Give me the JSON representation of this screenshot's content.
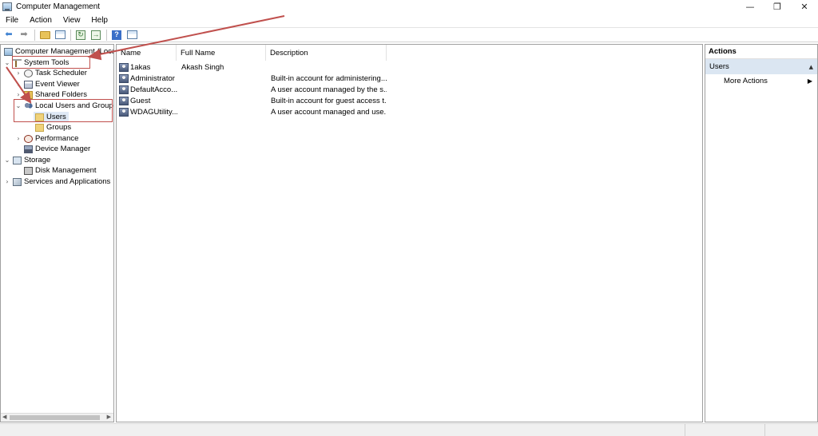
{
  "window": {
    "title": "Computer Management",
    "minimize_glyph": "—",
    "restore_glyph": "❐",
    "close_glyph": "✕"
  },
  "menu": [
    "File",
    "Action",
    "View",
    "Help"
  ],
  "toolbar": {
    "back_glyph": "⬅",
    "forward_glyph": "➡",
    "help_glyph": "?"
  },
  "tree": {
    "items": [
      {
        "label": "Computer Management (Local",
        "icon": "computer-management-icon",
        "expander": ""
      },
      {
        "label": "System Tools",
        "icon": "tools-icon",
        "expander": "⌄"
      },
      {
        "label": "Task Scheduler",
        "icon": "clock-icon",
        "expander": "›"
      },
      {
        "label": "Event Viewer",
        "icon": "event-viewer-icon",
        "expander": "›"
      },
      {
        "label": "Shared Folders",
        "icon": "shared-folder-icon",
        "expander": "›"
      },
      {
        "label": "Local Users and Groups",
        "icon": "users-group-icon",
        "expander": "⌄"
      },
      {
        "label": "Users",
        "icon": "folder-icon",
        "expander": ""
      },
      {
        "label": "Groups",
        "icon": "folder-icon",
        "expander": ""
      },
      {
        "label": "Performance",
        "icon": "performance-icon",
        "expander": "›"
      },
      {
        "label": "Device Manager",
        "icon": "device-manager-icon",
        "expander": ""
      },
      {
        "label": "Storage",
        "icon": "storage-icon",
        "expander": "⌄"
      },
      {
        "label": "Disk Management",
        "icon": "disk-icon",
        "expander": ""
      },
      {
        "label": "Services and Applications",
        "icon": "services-icon",
        "expander": "›"
      }
    ],
    "scroll_left": "◀",
    "scroll_right": "▶"
  },
  "list": {
    "columns": [
      "Name",
      "Full Name",
      "Description"
    ],
    "rows": [
      {
        "name": "1akas",
        "full_name": "Akash Singh",
        "description": ""
      },
      {
        "name": "Administrator",
        "full_name": "",
        "description": "Built-in account for administering..."
      },
      {
        "name": "DefaultAcco...",
        "full_name": "",
        "description": "A user account managed by the s..."
      },
      {
        "name": "Guest",
        "full_name": "",
        "description": "Built-in account for guest access t..."
      },
      {
        "name": "WDAGUtility...",
        "full_name": "",
        "description": "A user account managed and use..."
      }
    ]
  },
  "actions": {
    "title": "Actions",
    "section": "Users",
    "section_caret": "▲",
    "items": [
      {
        "label": "More Actions",
        "caret": "▶"
      }
    ]
  },
  "colors": {
    "annotation": "#c0504d",
    "selection": "#dbe6f2"
  }
}
